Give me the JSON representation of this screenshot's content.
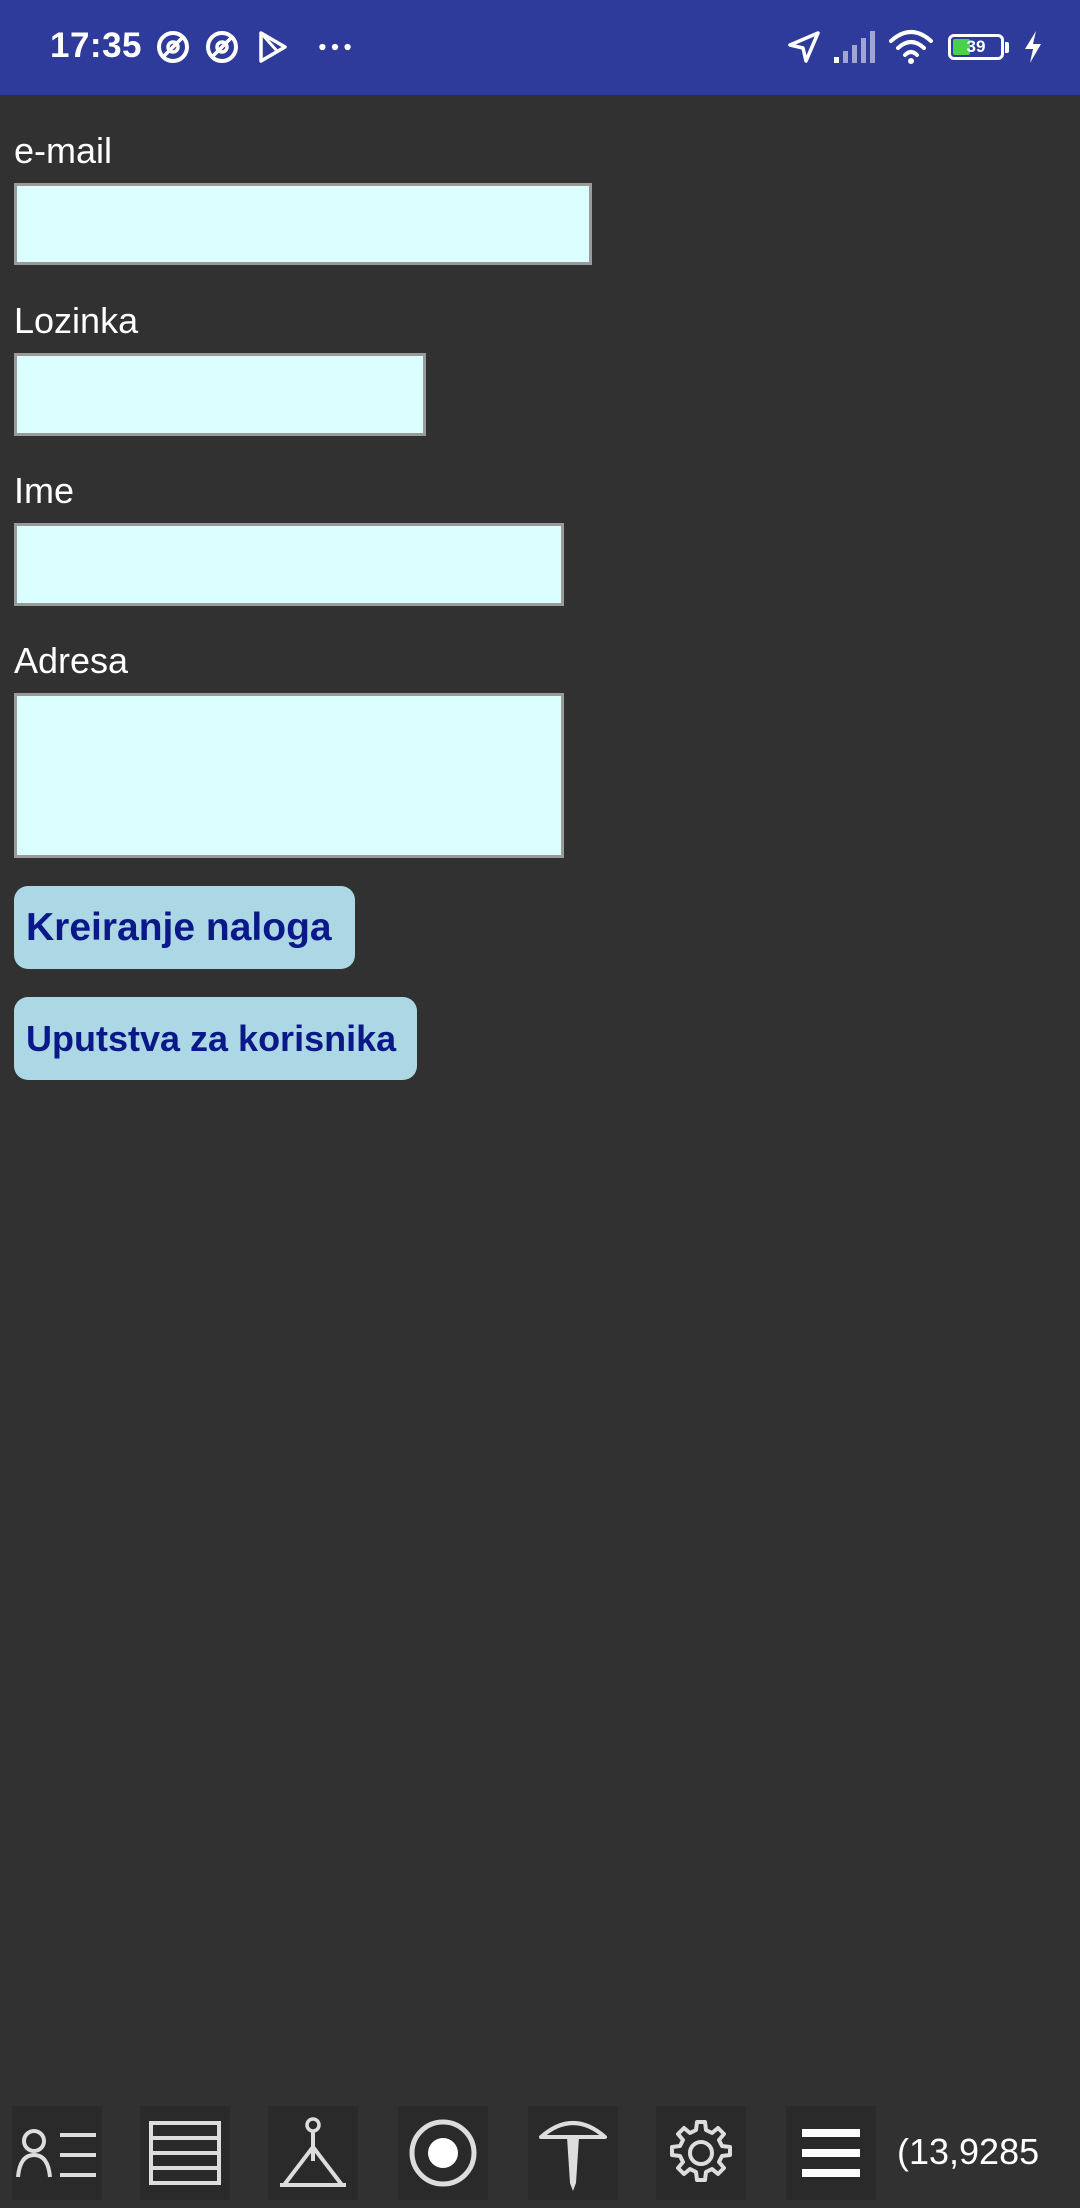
{
  "status_bar": {
    "time": "17:35",
    "battery_level": "39",
    "left_icons": [
      "at-sign-icon",
      "at-sign-icon",
      "play-store-icon",
      "more-dots-icon"
    ],
    "right_icons": [
      "location-arrow-icon",
      "signal-icon",
      "wifi-icon",
      "battery-icon",
      "charging-bolt-icon"
    ]
  },
  "form": {
    "email_label": "e-mail",
    "email_value": "",
    "password_label": "Lozinka",
    "password_value": "",
    "name_label": "Ime",
    "name_value": "",
    "address_label": "Adresa",
    "address_value": "",
    "create_account_button": "Kreiranje naloga",
    "user_guide_button": "Uputstva za korisnika"
  },
  "bottom_bar": {
    "icons": [
      "user-list-icon",
      "table-list-icon",
      "survey-stand-icon",
      "target-circle-icon",
      "stake-pin-icon",
      "gear-icon",
      "hamburger-menu-icon"
    ],
    "coords_text": "(13,9285"
  },
  "colors": {
    "status_bar_bg": "#2e3b9a",
    "background": "#313131",
    "input_bg": "#dbffff",
    "button_bg": "#acd7e5",
    "button_text": "#0b1888"
  }
}
